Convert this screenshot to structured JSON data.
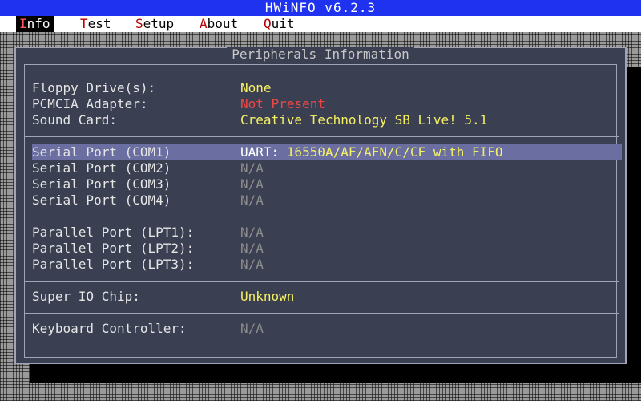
{
  "window": {
    "title": "HWiNFO v6.2.3"
  },
  "menu": {
    "items": [
      {
        "hot": "I",
        "rest": "nfo",
        "active": true
      },
      {
        "hot": "T",
        "rest": "est",
        "active": false
      },
      {
        "hot": "S",
        "rest": "etup",
        "active": false
      },
      {
        "hot": "A",
        "rest": "bout",
        "active": false
      },
      {
        "hot": "Q",
        "rest": "uit",
        "active": false
      }
    ]
  },
  "panel": {
    "title": "Peripherals Information",
    "rows": [
      {
        "label": "Floppy Drive(s):",
        "value": "None",
        "value_prefix": "",
        "color": "yellow"
      },
      {
        "label": "PCMCIA Adapter:",
        "value": "Not Present",
        "value_prefix": "",
        "color": "red"
      },
      {
        "label": "Sound Card:",
        "value": "Creative Technology SB Live! 5.1",
        "value_prefix": "",
        "color": "yellow"
      },
      {
        "label": "Serial Port (COM1)",
        "value": "16550A/AF/AFN/C/CF with FIFO",
        "value_prefix": "UART: ",
        "color": "yellow",
        "selected": true
      },
      {
        "label": "Serial Port (COM2)",
        "value": "N/A",
        "value_prefix": "",
        "color": "gray"
      },
      {
        "label": "Serial Port (COM3)",
        "value": "N/A",
        "value_prefix": "",
        "color": "gray"
      },
      {
        "label": "Serial Port (COM4)",
        "value": "N/A",
        "value_prefix": "",
        "color": "gray"
      },
      {
        "label": "Parallel Port (LPT1):",
        "value": "N/A",
        "value_prefix": "",
        "color": "gray"
      },
      {
        "label": "Parallel Port (LPT2):",
        "value": "N/A",
        "value_prefix": "",
        "color": "gray"
      },
      {
        "label": "Parallel Port (LPT3):",
        "value": "N/A",
        "value_prefix": "",
        "color": "gray"
      },
      {
        "label": "Super IO Chip:",
        "value": "Unknown",
        "value_prefix": "",
        "color": "yellow"
      },
      {
        "label": "Keyboard Controller:",
        "value": "N/A",
        "value_prefix": "",
        "color": "gray"
      }
    ]
  },
  "colors": {
    "titlebar": "#1e32f0",
    "panel": "#3b3f52",
    "selection": "#6a6ea0",
    "value_yellow": "#f5f064",
    "value_red": "#f04646",
    "value_gray": "#8c8c8c"
  }
}
